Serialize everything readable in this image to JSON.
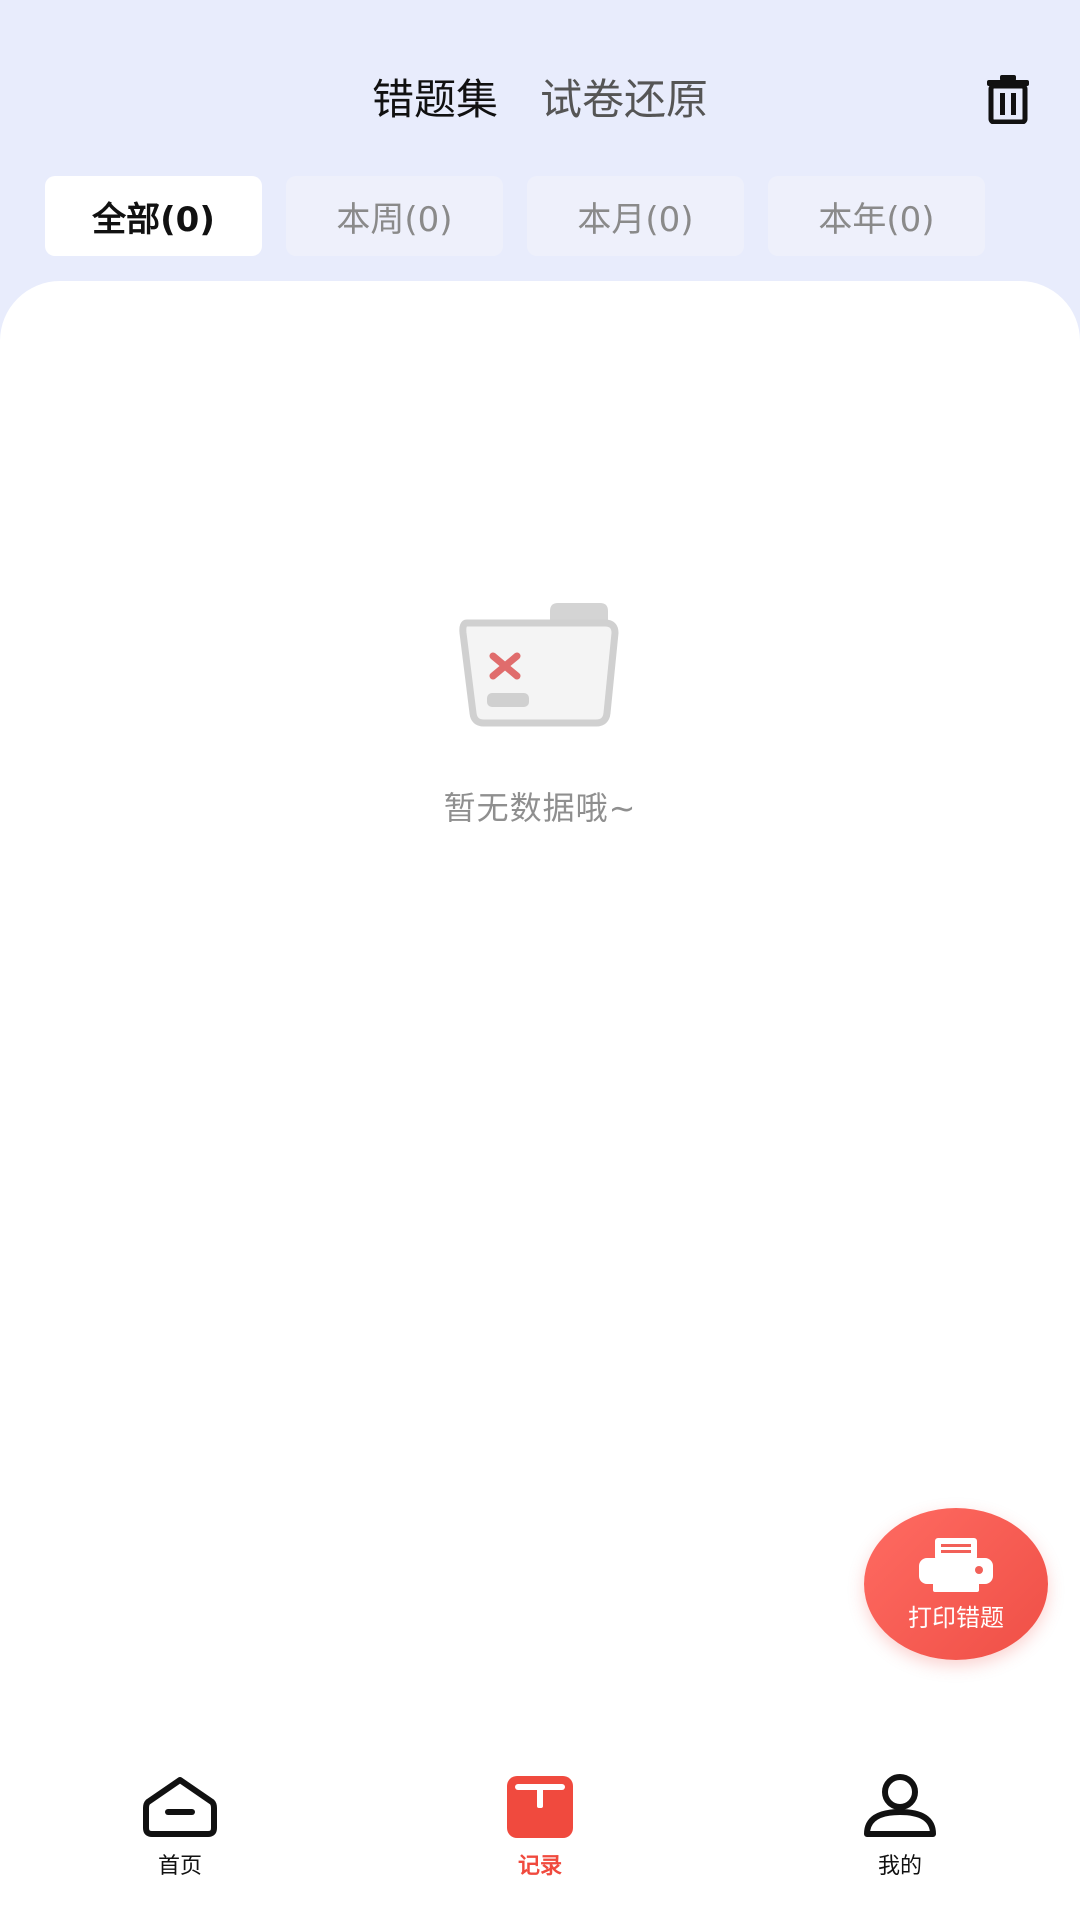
{
  "header": {
    "tabs": [
      {
        "label": "错题集",
        "active": true
      },
      {
        "label": "试卷还原",
        "active": false
      }
    ]
  },
  "filters": [
    {
      "label": "全部(0)",
      "active": true
    },
    {
      "label": "本周(0)",
      "active": false
    },
    {
      "label": "本月(0)",
      "active": false
    },
    {
      "label": "本年(0)",
      "active": false
    }
  ],
  "empty_state": {
    "message": "暂无数据哦~",
    "icon": "empty-folder-icon"
  },
  "fab": {
    "label": "打印错题",
    "icon": "printer-icon"
  },
  "bottom_nav": [
    {
      "label": "首页",
      "icon": "home-icon",
      "active": false
    },
    {
      "label": "记录",
      "icon": "record-icon",
      "active": true
    },
    {
      "label": "我的",
      "icon": "user-icon",
      "active": false
    }
  ],
  "colors": {
    "accent": "#f04a3e",
    "header_bg": "#e8ecfc",
    "card_bg": "#ffffff"
  }
}
